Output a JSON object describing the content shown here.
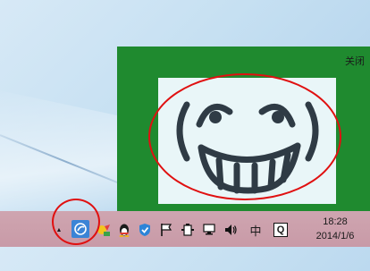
{
  "popup": {
    "close_label": "关闭",
    "background": "#1f8a2f"
  },
  "taskbar": {
    "items": [
      {
        "name": "show-hidden-icons-arrow",
        "glyph": "▲"
      },
      {
        "name": "network-app-icon",
        "glyph": ""
      },
      {
        "name": "weather-app-icon",
        "glyph": ""
      },
      {
        "name": "qq-penguin-icon",
        "glyph": ""
      },
      {
        "name": "security-shield-icon",
        "glyph": ""
      },
      {
        "name": "action-center-flag-icon",
        "glyph": ""
      },
      {
        "name": "power-battery-icon",
        "glyph": ""
      },
      {
        "name": "network-monitor-icon",
        "glyph": ""
      },
      {
        "name": "volume-icon",
        "glyph": ""
      },
      {
        "name": "input-method-icon",
        "glyph": "中"
      },
      {
        "name": "q-app-icon",
        "glyph": "Q"
      }
    ]
  },
  "clock": {
    "time": "18:28",
    "date": "2014/1/6"
  },
  "colors": {
    "highlight_ring": "#e01010",
    "taskbar": "#c89aa7",
    "face_stroke": "#2f3b45"
  }
}
